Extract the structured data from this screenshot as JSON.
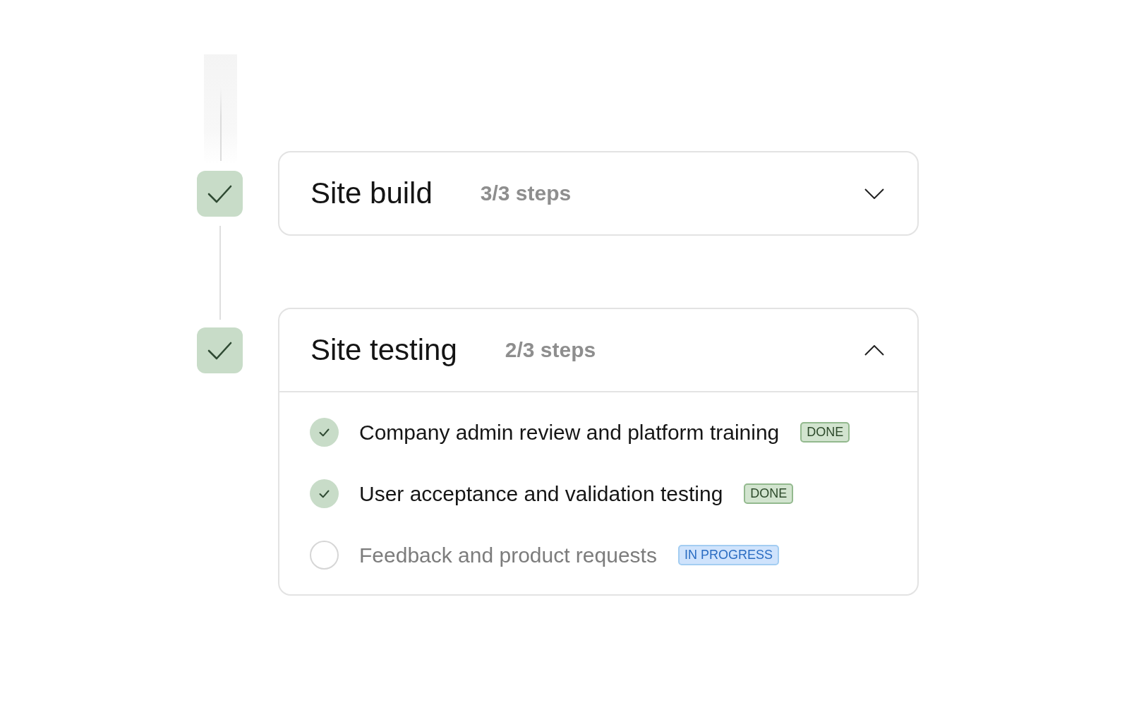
{
  "stages": [
    {
      "title": "Site build",
      "progress": "3/3 steps",
      "completed": true,
      "expanded": false
    },
    {
      "title": "Site testing",
      "progress": "2/3 steps",
      "completed": true,
      "expanded": true,
      "steps": [
        {
          "label": "Company admin review and platform training",
          "checked": true,
          "status": {
            "text": "DONE",
            "kind": "done"
          }
        },
        {
          "label": "User acceptance and validation testing",
          "checked": true,
          "status": {
            "text": "DONE",
            "kind": "done"
          }
        },
        {
          "label": "Feedback and product requests",
          "checked": false,
          "status": {
            "text": "IN PROGRESS",
            "kind": "in_progress"
          }
        }
      ]
    }
  ]
}
